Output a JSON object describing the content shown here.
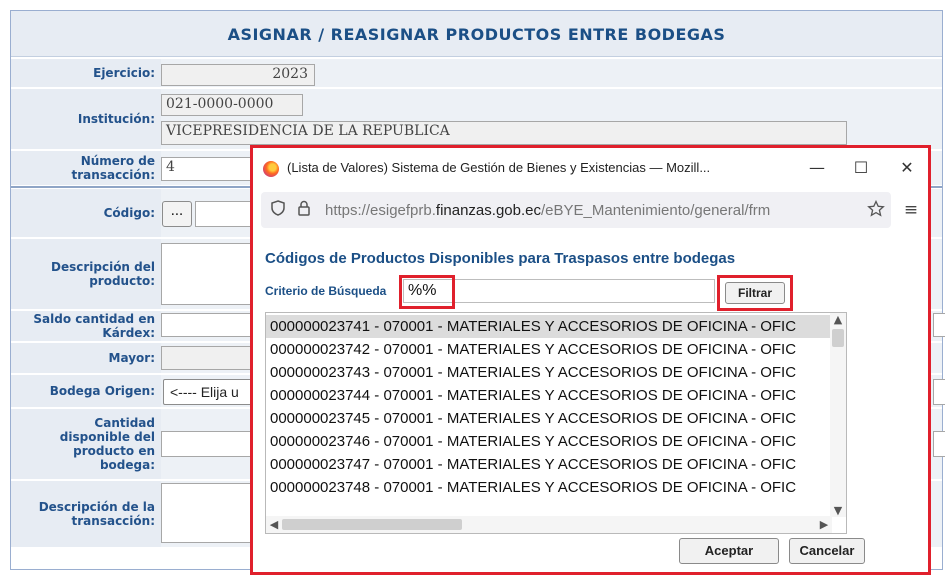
{
  "form": {
    "title": "ASIGNAR / REASIGNAR PRODUCTOS ENTRE BODEGAS",
    "ejercicio_label": "Ejercicio:",
    "ejercicio_value": "2023",
    "institucion_label": "Institución:",
    "institucion_code": "021-0000-0000",
    "institucion_name": "VICEPRESIDENCIA DE LA REPUBLICA",
    "numero_label_1": "Número de",
    "numero_label_2": "transacción:",
    "numero_value": "4",
    "codigo_label": "Código:",
    "codigo_button": "...",
    "descripcion_producto_label_1": "Descripción del",
    "descripcion_producto_label_2": "producto:",
    "saldo_label_1": "Saldo cantidad en",
    "saldo_label_2": "Kárdex:",
    "mayor_label": "Mayor:",
    "bodega_origen_label": "Bodega Origen:",
    "bodega_origen_value": "<---- Elija u",
    "cantidad_label_1": "Cantidad",
    "cantidad_label_2": "disponible del",
    "cantidad_label_3": "producto en",
    "cantidad_label_4": "bodega:",
    "descripcion_trans_label_1": "Descripción de la",
    "descripcion_trans_label_2": "transacción:"
  },
  "popup": {
    "window_title": "(Lista de Valores) Sistema de Gestión de Bienes y Existencias — Mozill...",
    "minimize": "—",
    "maximize": "☐",
    "close": "✕",
    "url_prefix": "https://esigefprb.",
    "url_domain": "finanzas.gob.ec",
    "url_suffix": "/eBYE_Mantenimiento/general/frm",
    "heading": "Códigos de Productos Disponibles para Traspasos entre bodegas",
    "criterio_label": "Criterio de Búsqueda",
    "search_value": "%%",
    "filtrar_label": "Filtrar",
    "items": [
      "000000023741 - 070001 - MATERIALES Y ACCESORIOS DE OFICINA - OFIC",
      "000000023742 - 070001 - MATERIALES Y ACCESORIOS DE OFICINA - OFIC",
      "000000023743 - 070001 - MATERIALES Y ACCESORIOS DE OFICINA - OFIC",
      "000000023744 - 070001 - MATERIALES Y ACCESORIOS DE OFICINA - OFIC",
      "000000023745 - 070001 - MATERIALES Y ACCESORIOS DE OFICINA - OFIC",
      "000000023746 - 070001 - MATERIALES Y ACCESORIOS DE OFICINA - OFIC",
      "000000023747 - 070001 - MATERIALES Y ACCESORIOS DE OFICINA - OFIC",
      "000000023748 - 070001 - MATERIALES Y ACCESORIOS DE OFICINA - OFIC"
    ],
    "aceptar_label": "Aceptar",
    "cancelar_label": "Cancelar"
  },
  "colors": {
    "highlight_red": "#e0202c",
    "label_blue": "#23528b",
    "label_bg": "#e7ecf3"
  }
}
